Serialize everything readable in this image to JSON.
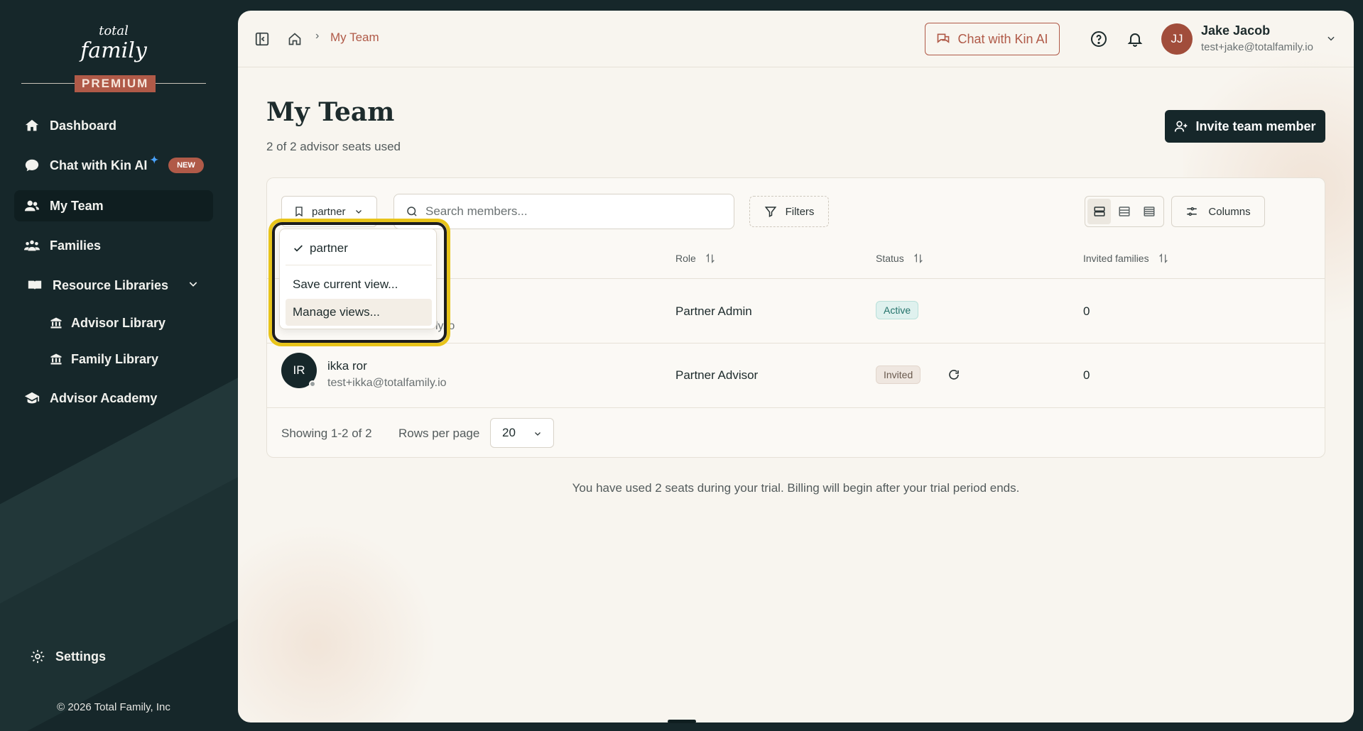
{
  "sidebar": {
    "logo": {
      "top": "total",
      "bottom": "family"
    },
    "premium": "PREMIUM",
    "items": [
      {
        "label": "Dashboard",
        "icon": "home-icon"
      },
      {
        "label": "Chat with Kin AI",
        "icon": "chat-bubble-icon",
        "badge": "NEW"
      },
      {
        "label": "My Team",
        "icon": "team-icon",
        "active": true
      },
      {
        "label": "Families",
        "icon": "families-icon"
      },
      {
        "label": "Resource Libraries",
        "icon": "book-icon"
      },
      {
        "label": "Advisor Academy",
        "icon": "graduation-cap-icon"
      }
    ],
    "sub_items": [
      {
        "label": "Advisor Library",
        "icon": "library-icon"
      },
      {
        "label": "Family Library",
        "icon": "library-icon"
      }
    ],
    "settings": "Settings",
    "copyright": "© 2026 Total Family, Inc"
  },
  "topbar": {
    "breadcrumb": "My Team",
    "chat_button": "Chat with Kin AI",
    "user": {
      "initials": "JJ",
      "name": "Jake Jacob",
      "email": "test+jake@totalfamily.io"
    }
  },
  "page": {
    "title": "My Team",
    "subtitle": "2 of 2 advisor seats used",
    "invite_button": "Invite team member",
    "trial_note": "You have used 2 seats during your trial. Billing will begin after your trial period ends."
  },
  "toolbar": {
    "view_selected": "partner",
    "search_placeholder": "Search members...",
    "filters": "Filters",
    "columns": "Columns"
  },
  "table": {
    "headers": {
      "role": "Role",
      "status": "Status",
      "invited_families": "Invited families"
    },
    "rows": [
      {
        "partial_email": "ly.io",
        "role": "Partner Admin",
        "status": "Active",
        "invited_families": "0"
      },
      {
        "initials": "IR",
        "name": "ikka ror",
        "email": "test+ikka@totalfamily.io",
        "role": "Partner Advisor",
        "status": "Invited",
        "invited_families": "0"
      }
    ],
    "showing": "Showing 1-2 of 2",
    "rows_per_page_label": "Rows per page",
    "rows_per_page": "20"
  },
  "dropdown": {
    "items": [
      "partner",
      "Save current view...",
      "Manage views..."
    ]
  },
  "colors": {
    "accent": "#b05a48",
    "sidebar": "#16272a",
    "highlight": "#e8c41a"
  }
}
